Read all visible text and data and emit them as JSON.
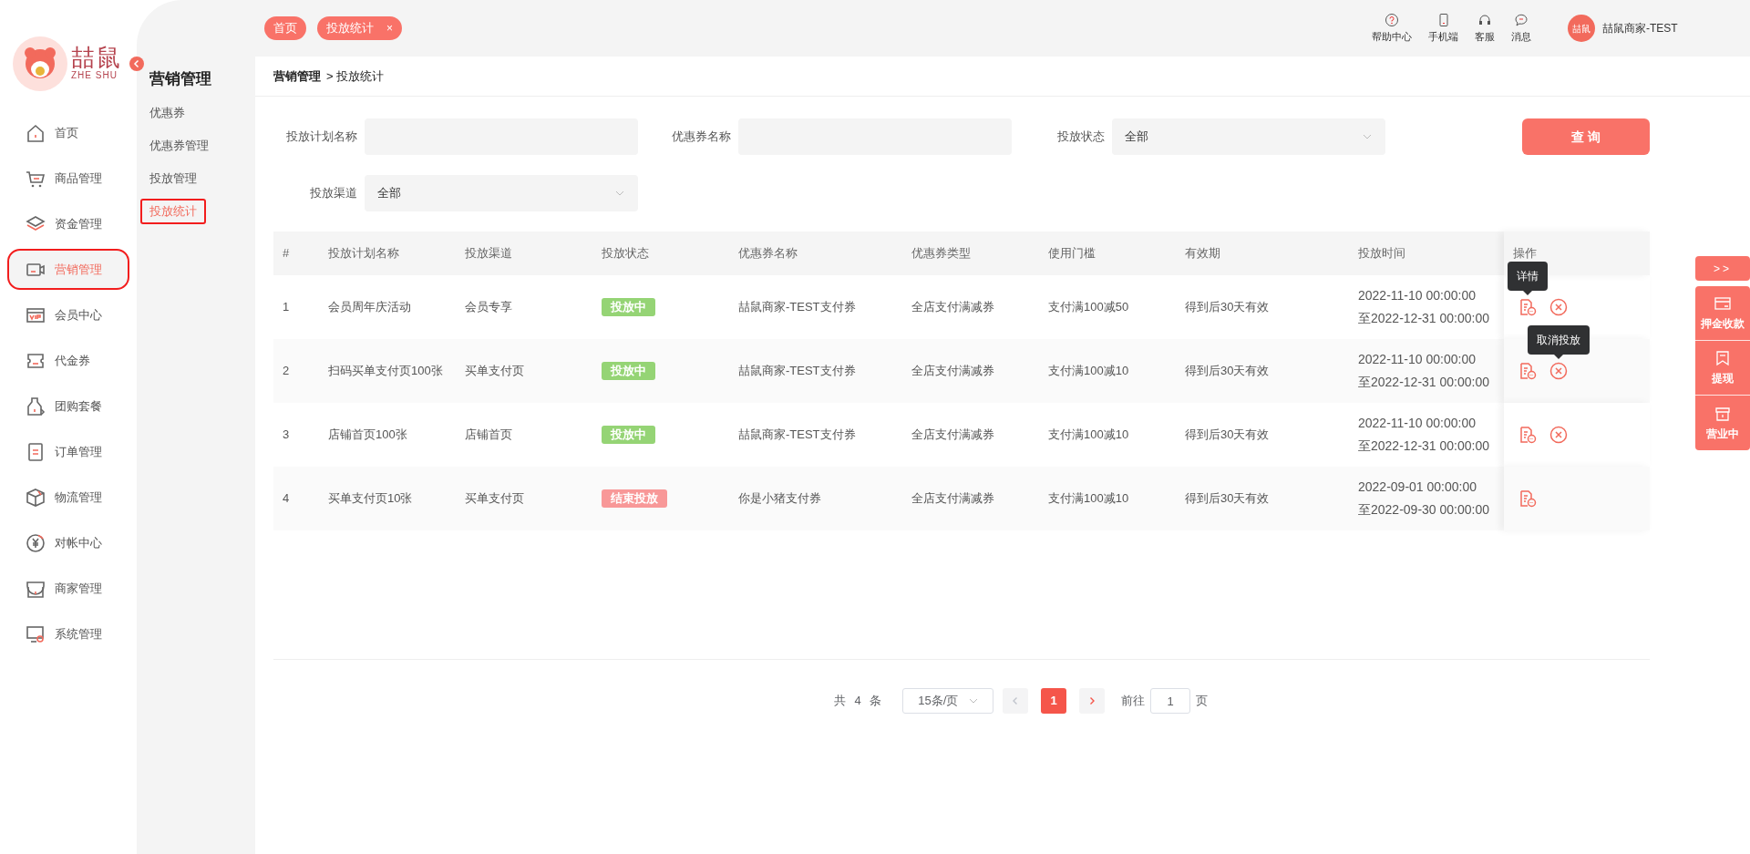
{
  "logo": {
    "title": "喆鼠",
    "subtitle": "ZHE SHU"
  },
  "sidebar": {
    "items": [
      {
        "label": "首页",
        "selected": false
      },
      {
        "label": "商品管理",
        "selected": false
      },
      {
        "label": "资金管理",
        "selected": false
      },
      {
        "label": "营销管理",
        "selected": true
      },
      {
        "label": "会员中心",
        "selected": false
      },
      {
        "label": "代金券",
        "selected": false
      },
      {
        "label": "团购套餐",
        "selected": false
      },
      {
        "label": "订单管理",
        "selected": false
      },
      {
        "label": "物流管理",
        "selected": false
      },
      {
        "label": "对帐中心",
        "selected": false
      },
      {
        "label": "商家管理",
        "selected": false
      },
      {
        "label": "系统管理",
        "selected": false
      }
    ]
  },
  "submenu": {
    "title": "营销管理",
    "items": [
      {
        "label": "优惠券",
        "selected": false
      },
      {
        "label": "优惠券管理",
        "selected": false
      },
      {
        "label": "投放管理",
        "selected": false
      },
      {
        "label": "投放统计",
        "selected": true
      }
    ]
  },
  "tabs": [
    {
      "label": "首页"
    },
    {
      "label": "投放统计",
      "close": "×"
    }
  ],
  "header_actions": [
    {
      "label": "帮助中心"
    },
    {
      "label": "手机端"
    },
    {
      "label": "客服"
    },
    {
      "label": "消息"
    }
  ],
  "user": {
    "avatar_text": "喆鼠",
    "name": "喆鼠商家-TEST"
  },
  "breadcrumb": [
    "营销管理",
    "> 投放统计"
  ],
  "filters": [
    {
      "label": "投放计划名称",
      "kind": "input"
    },
    {
      "label": "优惠券名称",
      "kind": "input"
    },
    {
      "label": "投放状态",
      "kind": "select",
      "value": "全部"
    },
    {
      "label": "投放渠道",
      "kind": "select",
      "value": "全部"
    }
  ],
  "query_button": "查 询",
  "table": {
    "columns": [
      "#",
      "投放计划名称",
      "投放渠道",
      "投放状态",
      "优惠券名称",
      "优惠券类型",
      "使用门槛",
      "有效期",
      "投放时间",
      "操作"
    ],
    "rows": [
      {
        "index": "1",
        "plan": "会员周年庆活动",
        "channel": "会员专享",
        "status": {
          "text": "投放中",
          "color": "#95d475"
        },
        "coupon": "喆鼠商家-TEST支付券",
        "type": "全店支付满减券",
        "threshold": "支付满100减50",
        "validity": "得到后30天有效",
        "time": [
          "2022-11-10 00:00:00",
          "至2022-12-31 00:00:00"
        ],
        "actions": [
          {
            "kind": "detail",
            "tooltip": "详情"
          },
          {
            "kind": "cancel"
          }
        ]
      },
      {
        "index": "2",
        "plan": "扫码买单支付页100张",
        "channel": "买单支付页",
        "status": {
          "text": "投放中",
          "color": "#95d475"
        },
        "coupon": "喆鼠商家-TEST支付券",
        "type": "全店支付满减券",
        "threshold": "支付满100减10",
        "validity": "得到后30天有效",
        "time": [
          "2022-11-10 00:00:00",
          "至2022-12-31 00:00:00"
        ],
        "actions": [
          {
            "kind": "detail"
          },
          {
            "kind": "cancel",
            "tooltip": "取消投放"
          }
        ]
      },
      {
        "index": "3",
        "plan": "店铺首页100张",
        "channel": "店铺首页",
        "status": {
          "text": "投放中",
          "color": "#95d475"
        },
        "coupon": "喆鼠商家-TEST支付券",
        "type": "全店支付满减券",
        "threshold": "支付满100减10",
        "validity": "得到后30天有效",
        "time": [
          "2022-11-10 00:00:00",
          "至2022-12-31 00:00:00"
        ],
        "actions": [
          {
            "kind": "detail"
          },
          {
            "kind": "cancel"
          }
        ]
      },
      {
        "index": "4",
        "plan": "买单支付页10张",
        "channel": "买单支付页",
        "status": {
          "text": "结束投放",
          "color": "#f89898"
        },
        "coupon": "你是小猪支付券",
        "type": "全店支付满减券",
        "threshold": "支付满100减10",
        "validity": "得到后30天有效",
        "time": [
          "2022-09-01 00:00:00",
          "至2022-09-30 00:00:00"
        ],
        "actions": [
          {
            "kind": "detail"
          }
        ]
      }
    ]
  },
  "pagination": {
    "total": "共 4 条",
    "page_size": "15条/页",
    "pages": [
      {
        "label": "1",
        "selected": true
      }
    ],
    "goto_label": "前往",
    "goto_value": "1",
    "goto_suffix": "页"
  },
  "float_panel": {
    "toggle": ">>",
    "items": [
      {
        "label": "押金收款"
      },
      {
        "label": "提现"
      },
      {
        "label": "营业中"
      }
    ]
  }
}
